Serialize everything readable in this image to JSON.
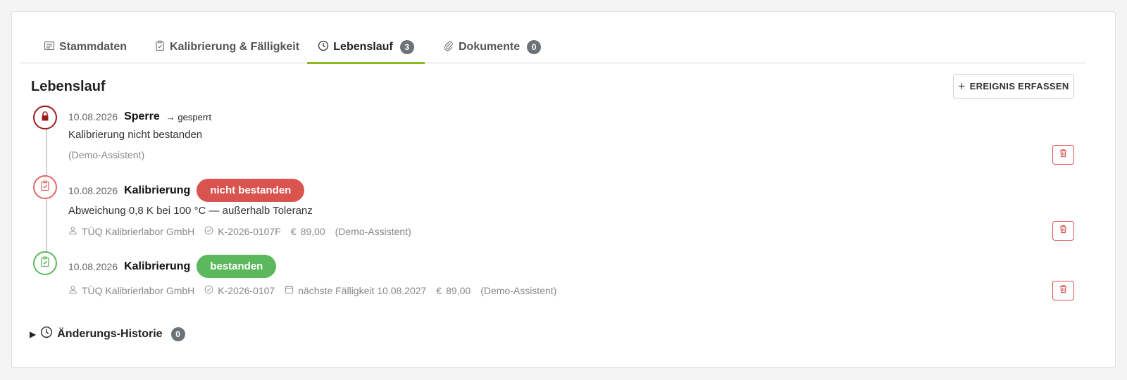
{
  "tabs": [
    {
      "label": "Stammdaten",
      "icon": "list-icon"
    },
    {
      "label": "Kalibrierung & Fälligkeit",
      "icon": "clipboard-check-icon"
    },
    {
      "label": "Lebenslauf",
      "icon": "clock-icon",
      "count": "3",
      "active": true
    },
    {
      "label": "Dokumente",
      "icon": "paperclip-icon",
      "count": "0"
    }
  ],
  "section": {
    "title": "Lebenslauf",
    "add_button": {
      "plus": "+",
      "label": "EREIGNIS ERFASSEN"
    }
  },
  "events": [
    {
      "date": "10.08.2026",
      "type": "Sperre",
      "status_change": "→ gesperrt",
      "description": "Kalibrierung nicht bestanden",
      "author": "(Demo-Assistent)",
      "node_icon": "lock-icon",
      "node_color": "#9b1b1b"
    },
    {
      "date": "10.08.2026",
      "type": "Kalibrierung",
      "result": "nicht bestanden",
      "result_color": "#d9534f",
      "description": "Abweichung 0,8 K bei 100 °C — außerhalb Toleranz",
      "lab": "TÜQ Kalibrierlabor GmbH",
      "certificate": "K-2026-0107F",
      "currency": "€",
      "cost": "89,00",
      "author": "(Demo-Assistent)",
      "node_icon": "clipboard-check-icon",
      "node_color": "#e06666"
    },
    {
      "date": "10.08.2026",
      "type": "Kalibrierung",
      "result": "bestanden",
      "result_color": "#5cb85c",
      "lab": "TÜQ Kalibrierlabor GmbH",
      "certificate": "K-2026-0107",
      "next_due": "nächste Fälligkeit 10.08.2027",
      "currency": "€",
      "cost": "89,00",
      "author": "(Demo-Assistent)",
      "node_icon": "clipboard-check-icon",
      "node_color": "#5cb85c"
    }
  ],
  "history": {
    "caret": "▶",
    "label": "Änderungs-Historie",
    "count": "0"
  },
  "colors": {
    "accent": "#8cb825",
    "danger": "#d9534f",
    "success": "#5cb85c",
    "badge": "#6b7278"
  }
}
